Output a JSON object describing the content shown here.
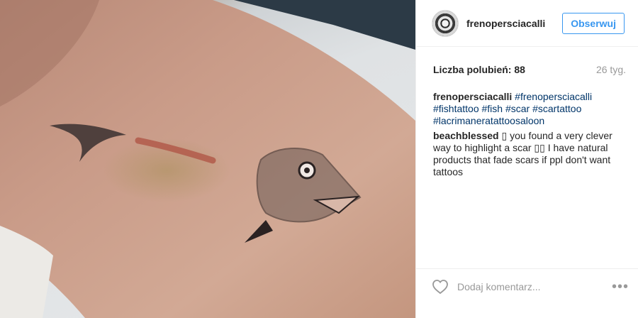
{
  "post": {
    "image_alt": "",
    "author": "frenopersciacalli",
    "follow_label": "Obserwuj",
    "likes_text": "Liczba polubień: 88",
    "age": "26 tyg.",
    "caption": {
      "user": "frenopersciacalli",
      "tags": [
        "#frenopersciacalli",
        "#fishtattoo",
        "#fish",
        "#scar",
        "#scartattoo",
        "#lacrimaneratattoosaloon"
      ]
    },
    "comments": [
      {
        "user": "beachblessed",
        "text": "▯ you found a very clever way to highlight a scar ▯▯ I have natural products that fade scars if ppl don't want tattoos"
      }
    ],
    "add_comment_placeholder": "Dodaj komentarz...",
    "more_icon": "•••"
  },
  "colors": {
    "link": "#003569",
    "follow_blue": "#3897f0",
    "muted": "#999999",
    "text": "#262626"
  },
  "icons": {
    "heart": "heart-icon",
    "more": "more-options-icon",
    "avatar": "avatar"
  }
}
